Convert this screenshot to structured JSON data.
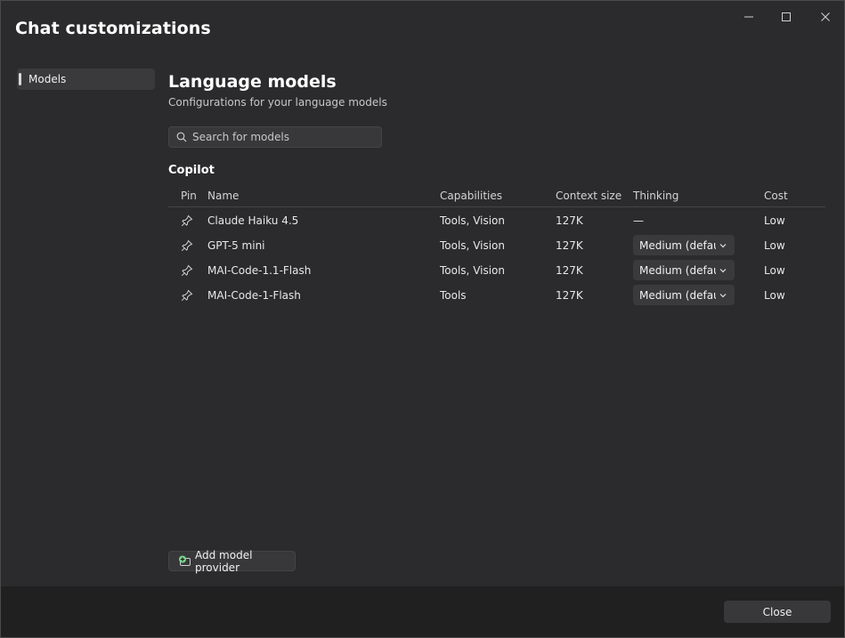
{
  "window": {
    "title": "Chat customizations",
    "controls": [
      "minimize-icon",
      "maximize-icon",
      "close-icon"
    ]
  },
  "sidebar": {
    "items": [
      {
        "label": "Models",
        "selected": true
      }
    ]
  },
  "main": {
    "heading": "Language models",
    "subheading": "Configurations for your language models",
    "search": {
      "placeholder": "Search for models",
      "value": ""
    },
    "group_title": "Copilot",
    "columns": {
      "pin": "Pin",
      "name": "Name",
      "capabilities": "Capabilities",
      "context": "Context size",
      "thinking": "Thinking",
      "cost": "Cost"
    },
    "rows": [
      {
        "name": "Claude Haiku 4.5",
        "capabilities": "Tools, Vision",
        "context": "127K",
        "thinking": "—",
        "cost": "Low"
      },
      {
        "name": "GPT-5 mini",
        "capabilities": "Tools, Vision",
        "context": "127K",
        "thinking": "Medium (default)",
        "cost": "Low"
      },
      {
        "name": "MAI-Code-1.1-Flash",
        "capabilities": "Tools, Vision",
        "context": "127K",
        "thinking": "Medium (default)",
        "cost": "Low"
      },
      {
        "name": "MAI-Code-1-Flash",
        "capabilities": "Tools",
        "context": "127K",
        "thinking": "Medium (default)",
        "cost": "Low"
      }
    ],
    "add_provider_label": "Add model provider"
  },
  "footer": {
    "close_label": "Close"
  },
  "colors": {
    "background": "#2b2b2d",
    "footer": "#202021",
    "control": "#3a3a3c",
    "accent_icon": "#7bd88f"
  }
}
